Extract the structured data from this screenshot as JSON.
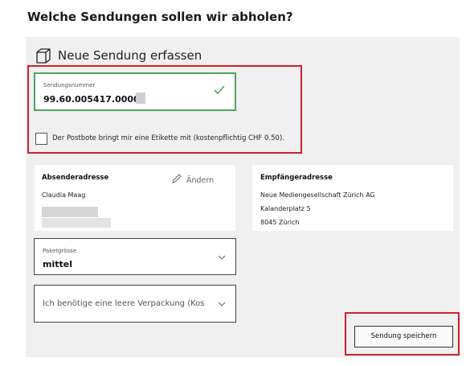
{
  "page": {
    "title": "Welche Sendungen sollen wir abholen?"
  },
  "panel": {
    "heading": "Neue Sendung erfassen",
    "icon": "package-box-icon"
  },
  "tracking": {
    "label": "Sendungsnummer",
    "value": "99.60.005417.00006",
    "valid_icon": "checkmark-icon",
    "valid_color": "#4fa45c"
  },
  "label_option": {
    "checked": false,
    "label": "Der Postbote bringt mir eine Etikette mit (kostenpflichtig CHF 0.50)."
  },
  "sender": {
    "title": "Absenderadresse",
    "name": "Claudia Maag",
    "edit_label": "Ändern",
    "edit_icon": "pencil-icon"
  },
  "recipient": {
    "title": "Empfängeradresse",
    "lines": [
      "Neue Mediengesellschaft Zürich AG",
      "Kalanderplatz 5",
      "8045 Zürich"
    ]
  },
  "package_size": {
    "label": "Paketgrösse",
    "value": "mittel"
  },
  "packaging": {
    "value": "Ich benötige eine leere Verpackung (Kos"
  },
  "actions": {
    "save_label": "Sendung speichern"
  },
  "colors": {
    "highlight": "#d0202a",
    "panel_bg": "#f0f0f0",
    "valid": "#4fa45c"
  }
}
